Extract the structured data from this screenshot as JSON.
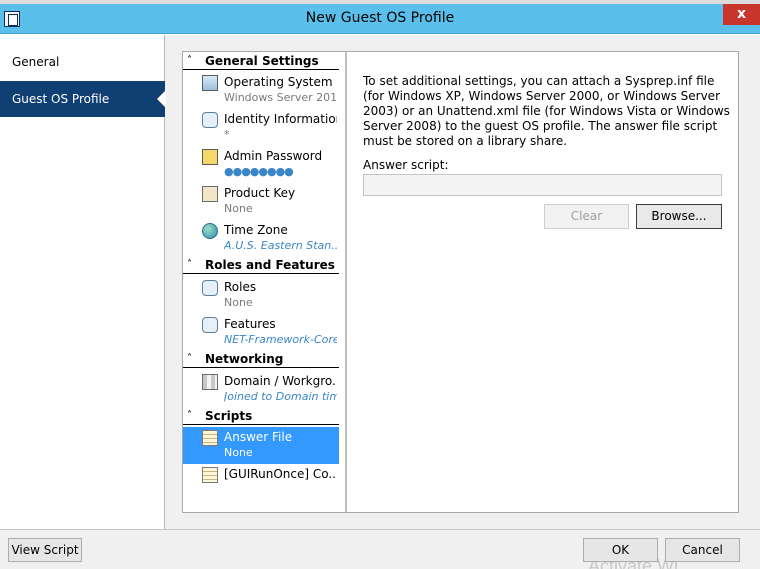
{
  "window": {
    "title": "New Guest OS Profile",
    "close_glyph": "x"
  },
  "nav": {
    "items": [
      {
        "label": "General"
      },
      {
        "label": "Guest OS Profile"
      }
    ]
  },
  "tree": {
    "caret_glyph": "˄",
    "sections": [
      {
        "title": "General Settings"
      },
      {
        "title": "Roles and Features"
      },
      {
        "title": "Networking"
      },
      {
        "title": "Scripts"
      }
    ],
    "items": [
      {
        "label": "Operating System",
        "value": "Windows Server 201..."
      },
      {
        "label": "Identity Information",
        "value": "*"
      },
      {
        "label": "Admin Password",
        "value": "●●●●●●●●"
      },
      {
        "label": "Product Key",
        "value": "None"
      },
      {
        "label": "Time Zone",
        "value": "A.U.S. Eastern Stan..."
      },
      {
        "label": "Roles",
        "value": "None"
      },
      {
        "label": "Features",
        "value": "NET-Framework-Core"
      },
      {
        "label": "Domain / Workgro...",
        "value": "Joined to Domain tim..."
      },
      {
        "label": "Answer File",
        "value": "None"
      },
      {
        "label": "[GUIRunOnce] Co...",
        "value": ""
      }
    ]
  },
  "detail": {
    "description": "To set additional settings, you can attach a Sysprep.inf file (for Windows XP, Windows Server 2000, or Windows Server 2003) or an Unattend.xml file (for Windows Vista or Windows Server 2008) to the guest OS profile. The answer file script must be stored on a library share.",
    "answer_label": "Answer script:",
    "answer_value": "",
    "clear_label": "Clear",
    "browse_label": "Browse..."
  },
  "footer": {
    "view_script_label": "View Script",
    "ok_label": "OK",
    "cancel_label": "Cancel",
    "watermark": "Activate Wi"
  }
}
